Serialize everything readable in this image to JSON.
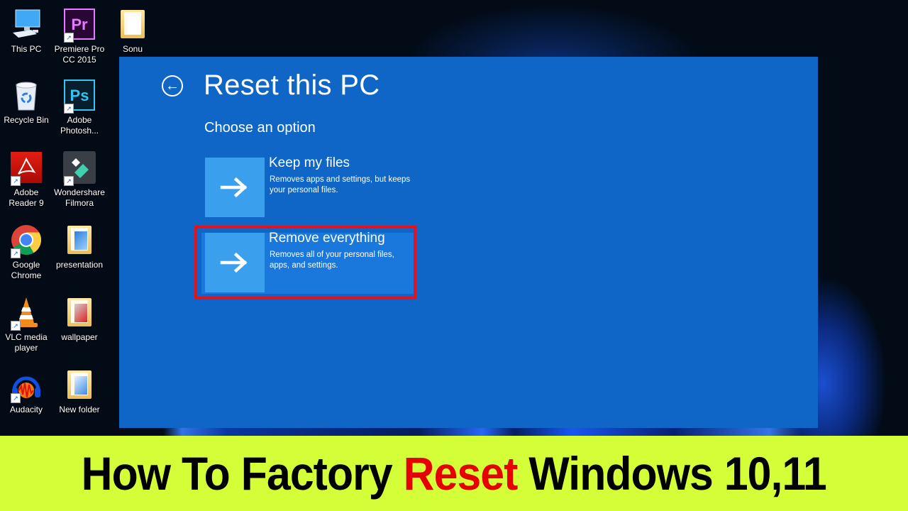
{
  "desktop": {
    "icons": [
      {
        "label": "This PC",
        "icon": "this-pc-icon"
      },
      {
        "label": "Premiere Pro CC 2015",
        "label_lines": [
          "Premiere Pro",
          "CC 2015"
        ],
        "icon": "premiere-pro-icon",
        "glyph": "Pr",
        "shortcut": true
      },
      {
        "label": "Sonu",
        "icon": "folder-icon"
      },
      {
        "label": "Recycle Bin",
        "icon": "recycle-bin-icon"
      },
      {
        "label": "Adobe Photosh...",
        "label_lines": [
          "Adobe",
          "Photosh..."
        ],
        "icon": "photoshop-icon",
        "glyph": "Ps",
        "shortcut": true
      },
      {
        "label": "Adobe Reader 9",
        "label_lines": [
          "Adobe",
          "Reader 9"
        ],
        "icon": "adobe-reader-icon",
        "shortcut": true
      },
      {
        "label": "Wondershare Filmora",
        "label_lines": [
          "Wondershare",
          "Filmora"
        ],
        "icon": "filmora-icon",
        "shortcut": true
      },
      {
        "label": "Google Chrome",
        "label_lines": [
          "Google",
          "Chrome"
        ],
        "icon": "chrome-icon",
        "shortcut": true
      },
      {
        "label": "presentation",
        "icon": "folder-icon"
      },
      {
        "label": "VLC media player",
        "label_lines": [
          "VLC media",
          "player"
        ],
        "icon": "vlc-icon",
        "shortcut": true
      },
      {
        "label": "wallpaper",
        "icon": "folder-icon"
      },
      {
        "label": "Audacity",
        "icon": "audacity-icon",
        "shortcut": true
      },
      {
        "label": "New folder",
        "icon": "folder-icon"
      }
    ]
  },
  "reset_window": {
    "back_icon": "back-arrow-icon",
    "title": "Reset this PC",
    "subtitle": "Choose an option",
    "options": [
      {
        "title": "Keep my files",
        "description": "Removes apps and settings, but keeps your personal files.",
        "icon": "arrow-right-icon",
        "selected": false
      },
      {
        "title": "Remove everything",
        "description": "Removes all of your personal files, apps, and settings.",
        "icon": "arrow-right-icon",
        "selected": true
      }
    ],
    "colors": {
      "background": "#0f66c6",
      "tile": "#3aa0ee",
      "highlight_border": "#e5121b"
    }
  },
  "banner": {
    "text_before": "How To Factory ",
    "text_accent": "Reset",
    "text_after": " Windows 10,11",
    "colors": {
      "background": "#d4ff38",
      "text": "#000000",
      "accent": "#e60000"
    }
  }
}
